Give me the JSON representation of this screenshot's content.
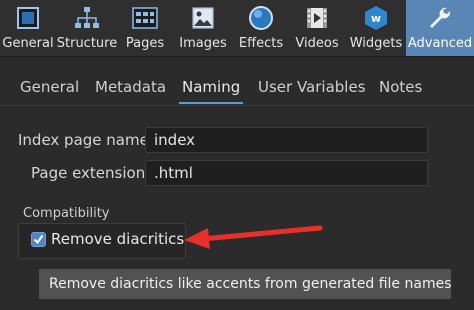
{
  "toolbar": {
    "items": [
      {
        "label": "General",
        "icon": "general-icon",
        "active": false
      },
      {
        "label": "Structure",
        "icon": "structure-icon",
        "active": false
      },
      {
        "label": "Pages",
        "icon": "pages-icon",
        "active": false
      },
      {
        "label": "Images",
        "icon": "images-icon",
        "active": false
      },
      {
        "label": "Effects",
        "icon": "effects-icon",
        "active": false
      },
      {
        "label": "Videos",
        "icon": "videos-icon",
        "active": false
      },
      {
        "label": "Widgets",
        "icon": "widgets-icon",
        "active": false
      },
      {
        "label": "Advanced",
        "icon": "wrench-icon",
        "active": true
      }
    ],
    "widgets_icon_glyph": "w"
  },
  "tabs": [
    "General",
    "Metadata",
    "Naming",
    "User Variables",
    "Notes"
  ],
  "active_tab": "Naming",
  "form": {
    "index_label": "Index page name",
    "index_value": "index",
    "ext_label": "Page extension",
    "ext_value": ".html"
  },
  "compat": {
    "group_label": "Compatibility",
    "checkbox_label": "Remove diacritics",
    "checked": true
  },
  "tooltip": "Remove diacritics like accents from generated file names",
  "colors": {
    "accent": "#5a86b5",
    "arrow": "#e8302a",
    "tab_underline": "#5a9ad6"
  }
}
